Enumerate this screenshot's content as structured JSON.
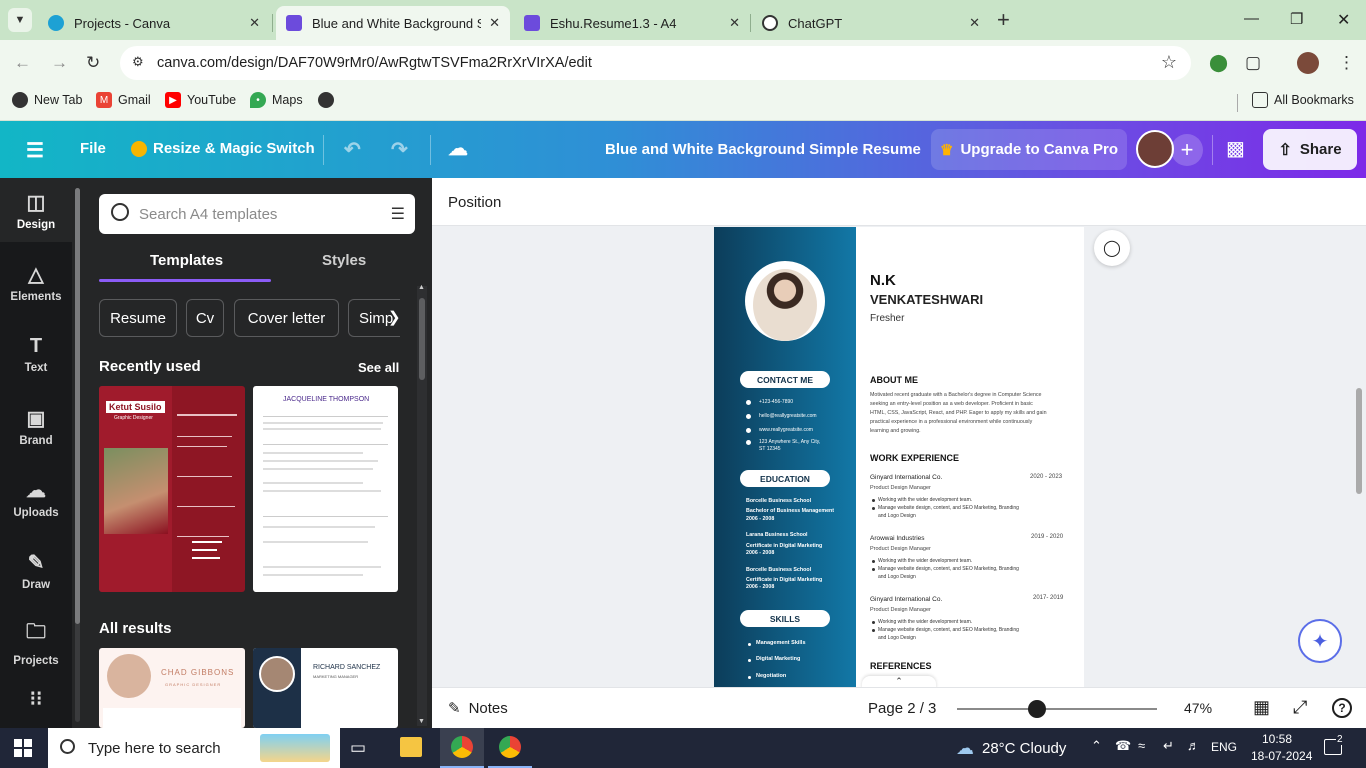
{
  "browser": {
    "tabs": [
      {
        "title": "Projects - Canva",
        "active": false
      },
      {
        "title": "Blue and White Background Sim",
        "active": true
      },
      {
        "title": "Eshu.Resume1.3 - A4",
        "active": false
      },
      {
        "title": "ChatGPT",
        "active": false
      }
    ],
    "url": "canva.com/design/DAF70W9rMr0/AwRgtwTSVFma2RrXrVIrXA/edit",
    "bookmarks": [
      "New Tab",
      "Gmail",
      "YouTube",
      "Maps"
    ],
    "all_bookmarks": "All Bookmarks"
  },
  "header": {
    "file": "File",
    "resize": "Resize & Magic Switch",
    "design_title": "Blue and White Background Simple Resume",
    "upgrade": "Upgrade to Canva Pro",
    "share": "Share"
  },
  "rail": [
    "Design",
    "Elements",
    "Text",
    "Brand",
    "Uploads",
    "Draw",
    "Projects"
  ],
  "panel": {
    "search_placeholder": "Search A4 templates",
    "tabs": [
      "Templates",
      "Styles"
    ],
    "chips": [
      "Resume",
      "Cv",
      "Cover letter",
      "Simp"
    ],
    "recently_used": "Recently used",
    "see_all": "See all",
    "all_results": "All results",
    "thumbs": {
      "t1_name": "Ketut Susilo",
      "t1_role": "Graphic Designer",
      "t2_name": "JACQUELINE THOMPSON",
      "t3_name": "CHAD GIBBONS",
      "t3_role": "GRAPHIC DESIGNER",
      "t4_name": "RICHARD SANCHEZ",
      "t4_role": "MARKETING MANAGER"
    }
  },
  "canvas": {
    "position": "Position",
    "notes": "Notes",
    "page": "Page 2 / 3",
    "zoom": "47%",
    "zoom_fraction": 0.47
  },
  "resume": {
    "first_name": "N.K",
    "last_name": "VENKATESHWARI",
    "title": "Fresher",
    "contact_heading": "CONTACT ME",
    "contact": [
      "+123-456-7890",
      "hello@reallygreatsite.com",
      "www.reallygreatsite.com",
      "123 Anywhere St., Any City,",
      "ST 12345"
    ],
    "education_heading": "EDUCATION",
    "education": [
      {
        "school": "Borcelle Business School",
        "degree": "Bachelor of Business Management",
        "years": "2006 - 2008"
      },
      {
        "school": "Larana Business School",
        "degree": "Certificate in Digital Marketing",
        "years": "2006 - 2008"
      },
      {
        "school": "Borcelle Business School",
        "degree": "Certificate in Digital Marketing",
        "years": "2006 - 2008"
      }
    ],
    "skills_heading": "SKILLS",
    "skills": [
      "Management Skills",
      "Digital Marketing",
      "Negotiation"
    ],
    "about_heading": "ABOUT ME",
    "about": [
      "Motivated recent graduate with a Bachelor's degree in Computer Science",
      "seeking an entry-level position as a web developer. Proficient in basic",
      "HTML, CSS, JavaScript, React, and PHP. Eager to apply my skills and gain",
      "practical experience in a professional environment while continuously",
      "learning and growing."
    ],
    "work_heading": "WORK EXPERIENCE",
    "jobs": [
      {
        "company": "Ginyard International Co.",
        "years": "2020 - 2023",
        "role": "Product Design Manager",
        "b1": "Working with the wider development team.",
        "b2": "Manage website design, content, and SEO Marketing, Branding",
        "b3": "and Logo Design"
      },
      {
        "company": "Arowwai Industries",
        "years": "2019 - 2020",
        "role": "Product Design Manager",
        "b1": "Working with the wider development team.",
        "b2": "Manage website design, content, and SEO Marketing, Branding",
        "b3": "and Logo Design"
      },
      {
        "company": "Ginyard International Co.",
        "years": "2017- 2019",
        "role": "Product Design Manager",
        "b1": "Working with the wider development team.",
        "b2": "Manage website design, content, and SEO Marketing, Branding",
        "b3": "and Logo Design"
      }
    ],
    "references_heading": "REFERENCES"
  },
  "taskbar": {
    "search_placeholder": "Type here to search",
    "weather": "28°C  Cloudy",
    "lang": "ENG",
    "time": "10:58",
    "date": "18-07-2024",
    "notifications": "2"
  },
  "colors": {
    "chrome_tab_bg": "#c9e4c8",
    "canva_gradient_start": "#12b6c6",
    "canva_gradient_end": "#7d2ae8",
    "panel_bg": "#252627",
    "resume_sidebar": "#0c3d5a"
  }
}
